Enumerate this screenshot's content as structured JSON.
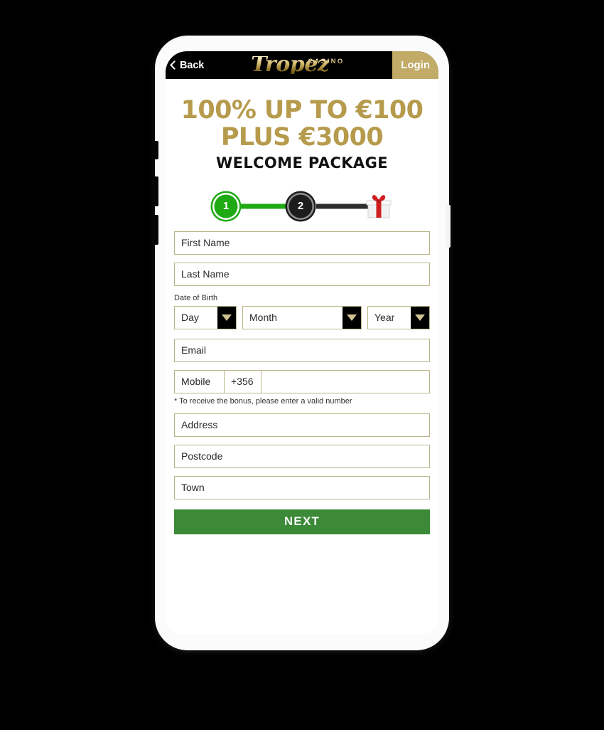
{
  "header": {
    "back_label": "Back",
    "logo_casino": "CASINO",
    "logo_brand": "Tropez",
    "login_label": "Login"
  },
  "promo": {
    "line1": "100% UP TO €100",
    "line2": "PLUS €3000",
    "subtitle": "WELCOME PACKAGE"
  },
  "stepper": {
    "step1": "1",
    "step2": "2",
    "active_step": 1,
    "active_color": "#1faa14",
    "inactive_color": "#1d1d1d"
  },
  "form": {
    "first_name_placeholder": "First Name",
    "first_name_value": "",
    "last_name_placeholder": "Last Name",
    "last_name_value": "",
    "dob_label": "Date of Birth",
    "day_value": "Day",
    "month_value": "Month",
    "year_value": "Year",
    "email_placeholder": "Email",
    "email_value": "",
    "mobile_label": "Mobile",
    "mobile_code": "+356",
    "mobile_placeholder": "",
    "mobile_value": "",
    "mobile_hint": "* To receive the bonus, please enter a valid number",
    "address_placeholder": "Address",
    "address_value": "",
    "postcode_placeholder": "Postcode",
    "postcode_value": "",
    "town_placeholder": "Town",
    "town_value": "",
    "next_label": "NEXT",
    "next_color": "#3c8a38"
  }
}
